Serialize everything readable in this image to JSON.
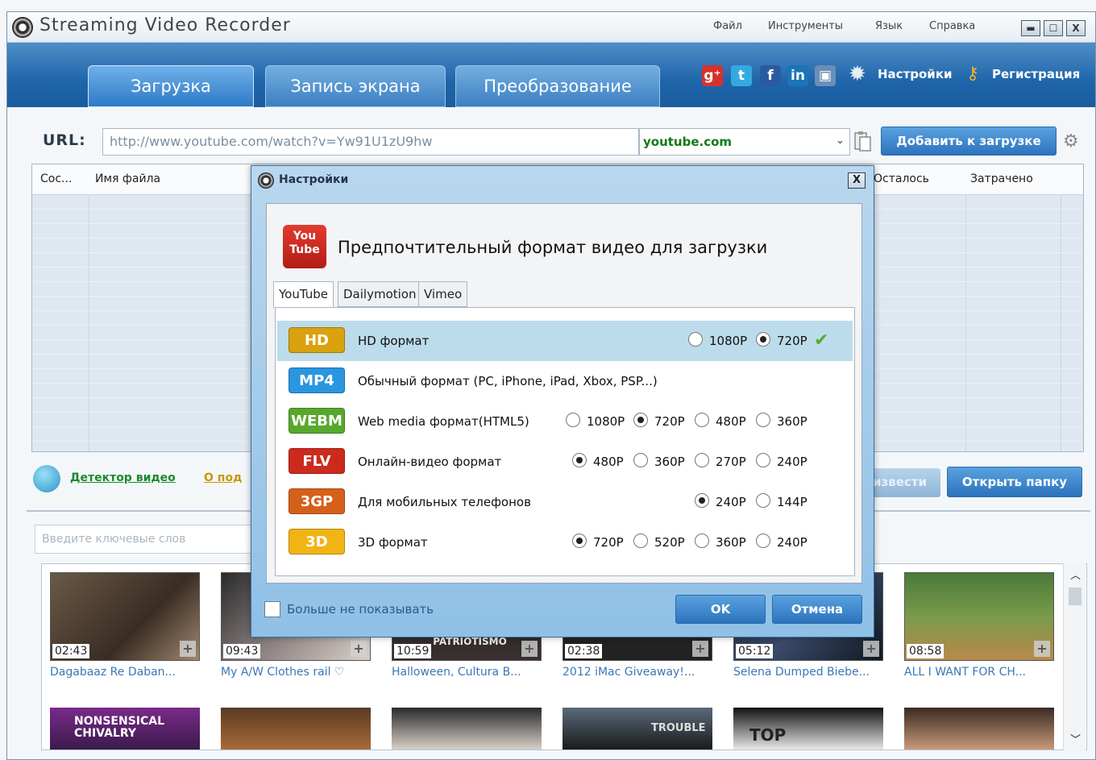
{
  "app": {
    "title": "Streaming Video Recorder",
    "menu": [
      "Файл",
      "Инструменты",
      "Язык",
      "Справка"
    ]
  },
  "window_controls": {
    "minimize": "▬",
    "maximize": "☐",
    "close": "X"
  },
  "tabs": [
    {
      "label": "Загрузка",
      "active": true
    },
    {
      "label": "Запись экрана",
      "active": false
    },
    {
      "label": "Преобразование",
      "active": false
    }
  ],
  "social": [
    {
      "name": "google-plus",
      "glyph": "g⁺",
      "color": "#d6322a"
    },
    {
      "name": "twitter",
      "glyph": "t",
      "color": "#34a9e0"
    },
    {
      "name": "facebook",
      "glyph": "f",
      "color": "#2c5aa0"
    },
    {
      "name": "linkedin",
      "glyph": "in",
      "color": "#1a74b8"
    },
    {
      "name": "blogger",
      "glyph": "▣",
      "color": "#6a8fb8"
    }
  ],
  "toolbar": {
    "settings": "Настройки",
    "register": "Регистрация"
  },
  "url_bar": {
    "label": "URL:",
    "value": "http://www.youtube.com/watch?v=Yw91U1zU9hw",
    "site": "youtube.com",
    "add_button": "Добавить к загрузке"
  },
  "table": {
    "columns": [
      "Сос...",
      "Имя файла",
      "Осталось",
      "Затрачено"
    ]
  },
  "footer": {
    "detector": "Детектор видео",
    "about": "О под",
    "convert": "извести",
    "open_folder": "Открыть папку"
  },
  "search": {
    "placeholder": "Введите ключевые слов"
  },
  "videos": [
    {
      "duration": "02:43",
      "title": "Dagabaaz Re Daban..."
    },
    {
      "duration": "09:43",
      "title": "My A/W Clothes rail ♡"
    },
    {
      "duration": "10:59",
      "title": "Halloween, Cultura B...",
      "overlay": "HALLOWEEN E PATRIOTISMO"
    },
    {
      "duration": "02:38",
      "title": "2012 iMac Giveaway!..."
    },
    {
      "duration": "05:12",
      "title": "Selena Dumped Biebe..."
    },
    {
      "duration": "08:58",
      "title": "ALL I WANT FOR CH..."
    }
  ],
  "videos_row2_overlays": [
    "NONSENSICAL CHIVALRY",
    "",
    "",
    "TROUBLE",
    "TOP",
    ""
  ],
  "dialog": {
    "title": "Настройки",
    "close": "X",
    "heading": "Предпочтительный формат видео для загрузки",
    "yt_logo": [
      "You",
      "Tube"
    ],
    "tabs": [
      "YouTube",
      "Dailymotion",
      "Vimeo"
    ],
    "formats": [
      {
        "badge": "HD",
        "desc": "HD формат",
        "color": "#d9a20e",
        "options": [
          "1080P",
          "720P"
        ],
        "selected": 1,
        "row_selected": true
      },
      {
        "badge": "MP4",
        "desc": "Обычный формат (PC, iPhone, iPad, Xbox, PSP...)",
        "color": "#2a96e0",
        "options": [],
        "selected": -1
      },
      {
        "badge": "WEBM",
        "desc": "Web media формат(HTML5)",
        "color": "#57a82c",
        "options": [
          "1080P",
          "720P",
          "480P",
          "360P"
        ],
        "selected": 1
      },
      {
        "badge": "FLV",
        "desc": "Онлайн-видео формат",
        "color": "#cc2a1c",
        "options": [
          "480P",
          "360P",
          "270P",
          "240P"
        ],
        "selected": 0
      },
      {
        "badge": "3GP",
        "desc": "Для мобильных телефонов",
        "color": "#d5601a",
        "options": [
          "240P",
          "144P"
        ],
        "selected": 0
      },
      {
        "badge": "3D",
        "desc": "3D формат",
        "color": "#f0b414",
        "options": [
          "720P",
          "520P",
          "360P",
          "240P"
        ],
        "selected": 0
      }
    ],
    "no_show": "Больше не показывать",
    "ok": "OK",
    "cancel": "Отмена"
  }
}
